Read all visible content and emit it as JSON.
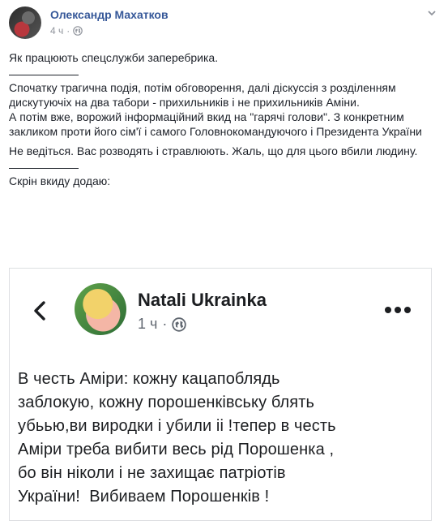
{
  "post": {
    "author": "Олександр Махатков",
    "time": "4 ч",
    "separator": "·",
    "paragraphs": [
      "Як працюють спецслужби заперебрика.",
      "Спочатку трагична подія, потім обговорення, далі діскуссія з розділенням дискутуючіх на два табори - прихильників і не прихильників Аміни.",
      "А потім вже, ворожий інформаційний вкид на \"гарячі голови\". З конкретним закликом проти його сім'ї і самого Головнокомандуючого і Президента України",
      "Не ведіться. Вас розводять і стравлюють. Жаль, що для цього вбили людину.",
      "Скрін вкиду додаю:"
    ]
  },
  "screenshot": {
    "author": "Natali Ukrainka",
    "time": "1 ч",
    "separator": "·",
    "lines": [
      "В честь Аміри: кожну кацапоблядь",
      "заблокую, кожну порошенківську блять",
      "убьью,ви виродки і убили іі !тепер в честь",
      "Аміри треба вибити весь рід Порошенка ,",
      "бо він ніколи і не захищає патріотів",
      "України!  Вибиваем Порошенків !"
    ]
  },
  "icons": {
    "globe": "globe-icon",
    "chevron": "chevron-down-icon",
    "back": "back-arrow-icon",
    "more": "more-dots-icon"
  },
  "colors": {
    "author_link": "#365899",
    "meta_gray": "#90949c",
    "text": "#1d2129"
  }
}
